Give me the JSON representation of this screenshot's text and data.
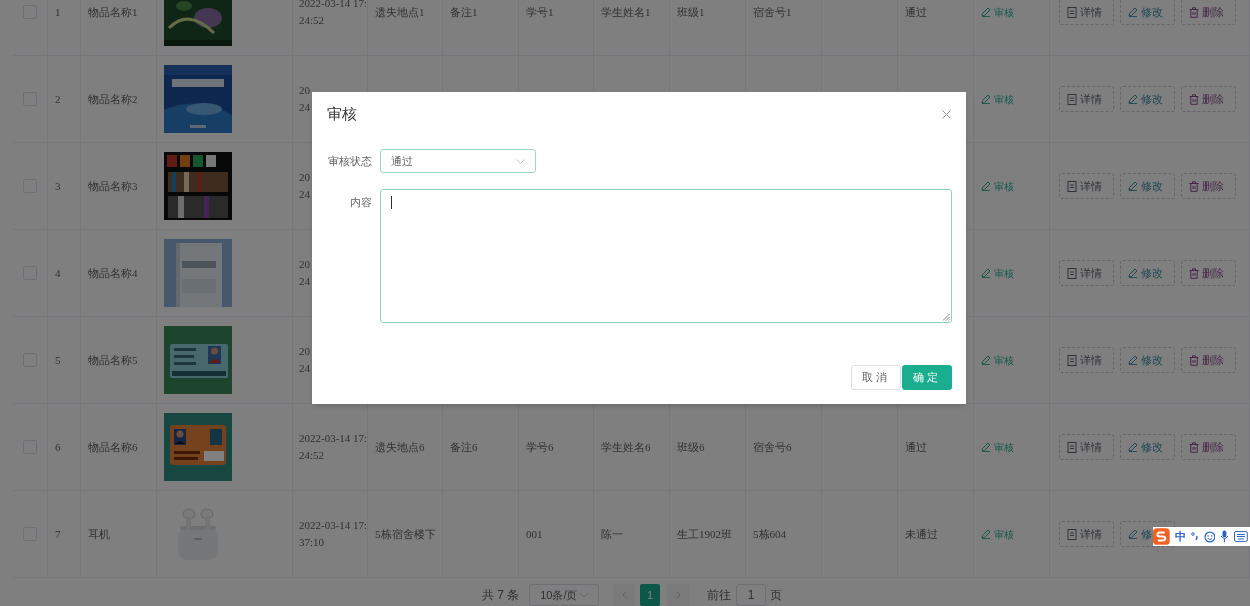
{
  "table": {
    "rows": [
      {
        "checked": false,
        "index": "1",
        "name": "物品名称1",
        "picture": {
          "kind": "picture"
        },
        "time": [
          "2022-03-14 17:",
          "24:52"
        ],
        "location": "遗失地点1",
        "note": "备注1",
        "student_no": "学号1",
        "student_name": "学生姓名1",
        "class": "班级1",
        "dorm": "宿舍号1",
        "status": "通过",
        "audit": "审核",
        "actions": [
          {
            "kind": "detail",
            "label": "详情"
          },
          {
            "kind": "edit",
            "label": "修改"
          },
          {
            "kind": "delete",
            "label": "删除"
          }
        ]
      },
      {
        "checked": false,
        "index": "2",
        "name": "物品名称2",
        "picture": {
          "kind": "picture"
        },
        "time": [
          "20",
          "24"
        ],
        "audit": "审核",
        "actions": [
          {
            "kind": "detail",
            "label": "详情"
          },
          {
            "kind": "edit",
            "label": "修改"
          },
          {
            "kind": "delete",
            "label": "删除"
          }
        ]
      },
      {
        "checked": false,
        "index": "3",
        "name": "物品名称3",
        "picture": {
          "kind": "picture"
        },
        "time": [
          "20",
          "24"
        ],
        "audit": "审核",
        "actions": [
          {
            "kind": "detail",
            "label": "详情"
          },
          {
            "kind": "edit",
            "label": "修改"
          },
          {
            "kind": "delete",
            "label": "删除"
          }
        ]
      },
      {
        "checked": false,
        "index": "4",
        "name": "物品名称4",
        "picture": {
          "kind": "picture"
        },
        "time": [
          "20",
          "24"
        ],
        "audit": "审核",
        "actions": [
          {
            "kind": "detail",
            "label": "详情"
          },
          {
            "kind": "edit",
            "label": "修改"
          },
          {
            "kind": "delete",
            "label": "删除"
          }
        ]
      },
      {
        "checked": false,
        "index": "5",
        "name": "物品名称5",
        "picture": {
          "kind": "picture"
        },
        "time": [
          "20",
          "24"
        ],
        "audit": "审核",
        "actions": [
          {
            "kind": "detail",
            "label": "详情"
          },
          {
            "kind": "edit",
            "label": "修改"
          },
          {
            "kind": "delete",
            "label": "删除"
          }
        ]
      },
      {
        "checked": false,
        "index": "6",
        "name": "物品名称6",
        "picture": {
          "kind": "picture"
        },
        "time": [
          "2022-03-14 17:",
          "24:52"
        ],
        "location": "遗失地点6",
        "note": "备注6",
        "student_no": "学号6",
        "student_name": "学生姓名6",
        "class": "班级6",
        "dorm": "宿舍号6",
        "status": "通过",
        "audit": "审核",
        "actions": [
          {
            "kind": "detail",
            "label": "详情"
          },
          {
            "kind": "edit",
            "label": "修改"
          },
          {
            "kind": "delete",
            "label": "删除"
          }
        ]
      },
      {
        "checked": false,
        "index": "7",
        "name": "耳机",
        "picture": {
          "kind": "picture"
        },
        "time": [
          "2022-03-14 17:",
          "37:10"
        ],
        "location": "5栋宿舍楼下",
        "student_no": "001",
        "student_name": "陈一",
        "class": "生工1902班",
        "dorm": "5栋604",
        "status": "未通过",
        "audit": "审核",
        "actions": [
          {
            "kind": "detail",
            "label": "详情"
          },
          {
            "kind": "edit",
            "label": "修"
          }
        ]
      }
    ]
  },
  "pagination": {
    "total": "共 7 条",
    "page_size": "10条/页",
    "pages": [
      {
        "label": "1",
        "selected": true
      }
    ],
    "goto_label": "前往",
    "goto_value": "1",
    "page_suffix": "页"
  },
  "modal": {
    "title": "审核",
    "fields": [
      {
        "kind": "select",
        "label": "审核状态",
        "value": "通过"
      },
      {
        "kind": "textarea",
        "label": "内容",
        "focused": true
      }
    ],
    "buttons": [
      {
        "kind": "default",
        "label": "取消"
      },
      {
        "kind": "primary",
        "label": "确定"
      }
    ]
  },
  "ime_toolbar": {
    "mode": "中"
  }
}
